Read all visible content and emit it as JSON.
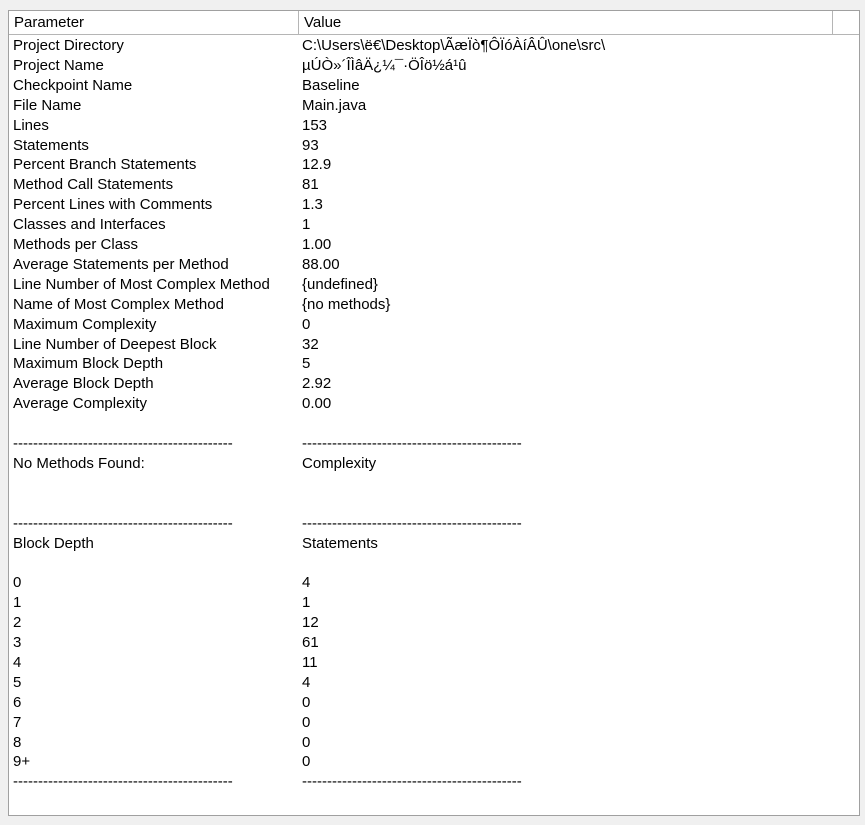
{
  "columns": {
    "parameter": "Parameter",
    "value": "Value"
  },
  "rows": [
    {
      "k": "Project Directory",
      "v": "C:\\Users\\ë€\\Desktop\\ÃæÏò¶ÔÏóÀíÂÛ\\one\\src\\"
    },
    {
      "k": "Project Name",
      "v": "µÚÒ»´ÎÌâÄ¿¼¯·ÖÎö½á¹û"
    },
    {
      "k": "Checkpoint Name",
      "v": "Baseline"
    },
    {
      "k": "File Name",
      "v": "Main.java"
    },
    {
      "k": "Lines",
      "v": "153"
    },
    {
      "k": "Statements",
      "v": "93"
    },
    {
      "k": "Percent Branch Statements",
      "v": "12.9"
    },
    {
      "k": "Method Call Statements",
      "v": "81"
    },
    {
      "k": "Percent Lines with Comments",
      "v": "1.3"
    },
    {
      "k": "Classes and Interfaces",
      "v": "1"
    },
    {
      "k": "Methods per Class",
      "v": "1.00"
    },
    {
      "k": "Average Statements per Method",
      "v": "88.00"
    },
    {
      "k": "Line Number of Most Complex Method",
      "v": "{undefined}"
    },
    {
      "k": "Name of Most Complex Method",
      "v": "{no methods}"
    },
    {
      "k": "Maximum Complexity",
      "v": "0"
    },
    {
      "k": "Line Number of Deepest Block",
      "v": "32"
    },
    {
      "k": "Maximum Block Depth",
      "v": "5"
    },
    {
      "k": "Average Block Depth",
      "v": "2.92"
    },
    {
      "k": "Average Complexity",
      "v": "0.00"
    },
    {
      "k": "",
      "v": ""
    },
    {
      "k": "--------------------------------------------",
      "v": "--------------------------------------------"
    },
    {
      "k": "No Methods Found:",
      "v": "Complexity"
    },
    {
      "k": "",
      "v": ""
    },
    {
      "k": "",
      "v": ""
    },
    {
      "k": "--------------------------------------------",
      "v": "--------------------------------------------"
    },
    {
      "k": "Block Depth",
      "v": "Statements"
    },
    {
      "k": "",
      "v": ""
    },
    {
      "k": "0",
      "v": "4"
    },
    {
      "k": "1",
      "v": "1"
    },
    {
      "k": "2",
      "v": "12"
    },
    {
      "k": "3",
      "v": "61"
    },
    {
      "k": "4",
      "v": "11"
    },
    {
      "k": "5",
      "v": "4"
    },
    {
      "k": "6",
      "v": "0"
    },
    {
      "k": "7",
      "v": "0"
    },
    {
      "k": "8",
      "v": "0"
    },
    {
      "k": "9+",
      "v": "0"
    },
    {
      "k": "--------------------------------------------",
      "v": "--------------------------------------------"
    }
  ]
}
